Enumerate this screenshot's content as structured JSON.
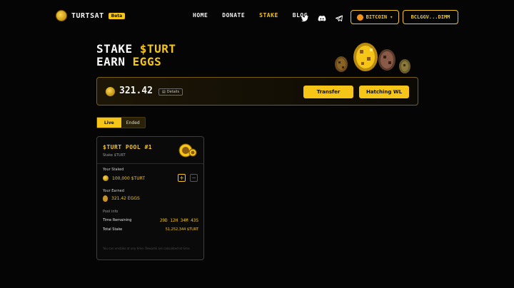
{
  "brand": {
    "name": "TURTSAT",
    "badge": "Beta"
  },
  "nav": {
    "links": [
      "HOME",
      "DONATE",
      "STAKE",
      "BLOG"
    ],
    "active": "STAKE"
  },
  "network_button": {
    "label": "BITCOIN"
  },
  "wallet_button": {
    "label": "BCLGGV...DIMM"
  },
  "hero": {
    "line1_prefix": "STAKE ",
    "line1_accent": "$TURT",
    "line2_prefix": "EARN ",
    "line2_accent": "EGGS"
  },
  "balance": {
    "value": "321.42",
    "details_label": "Details",
    "transfer_label": "Transfer",
    "hatching_label": "Hatching WL"
  },
  "tabs": {
    "live": "Live",
    "ended": "Ended"
  },
  "pool": {
    "title": "$TURT POOL #1",
    "subtitle": "Stake $TURT",
    "staked_label": "Your Staked",
    "staked_value": "100,000 $TURT",
    "earned_label": "Your Earned",
    "earned_value": "321.42 EGGS",
    "pool_info_label": "Pool info",
    "time_label": "Time Remaining",
    "time_value": "29D 12H 34M 43S",
    "total_label": "Total Stake",
    "total_value": "51,252,344 $TURT",
    "footer": "You can unstake at any time. Rewards are calculated at time."
  },
  "colors": {
    "accent": "#f5c518",
    "background": "#050505"
  }
}
